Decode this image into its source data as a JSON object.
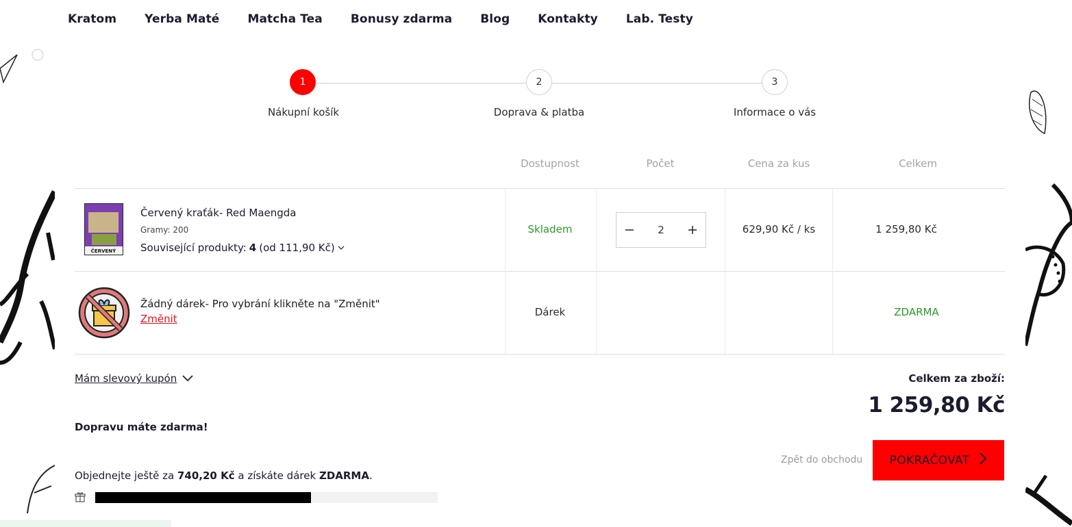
{
  "nav": [
    "Kratom",
    "Yerba Maté",
    "Matcha Tea",
    "Bonusy zdarma",
    "Blog",
    "Kontakty",
    "Lab. Testy"
  ],
  "steps": [
    {
      "num": "1",
      "label": "Nákupní košík"
    },
    {
      "num": "2",
      "label": "Doprava & platba"
    },
    {
      "num": "3",
      "label": "Informace o vás"
    }
  ],
  "table": {
    "headers": {
      "availability": "Dostupnost",
      "quantity": "Počet",
      "unit_price": "Cena za kus",
      "total": "Celkem"
    }
  },
  "product": {
    "name": "Červený kraťák- Red Maengda",
    "variant": "Gramy: 200",
    "related_label": "Související produkty:",
    "related_count": "4",
    "related_from": "(od 111,90 Kč)",
    "thumb_text": "ČERVENÝ",
    "availability": "Skladem",
    "quantity": "2",
    "unit_price": "629,90 Kč / ks",
    "total": "1 259,80 Kč"
  },
  "gift": {
    "text": "Žádný dárek- Pro vybrání klikněte na \"Změnit\"",
    "change": "Změnit",
    "type": "Dárek",
    "price": "ZDARMA"
  },
  "coupon_label": "Mám slevový kupón",
  "free_shipping": "Dopravu máte zdarma!",
  "order_more": {
    "prefix": "Objednejte ještě za",
    "amount": "740,20 Kč",
    "middle": "a získáte dárek",
    "gift": "ZDARMA",
    "suffix": "."
  },
  "progress": 0.63,
  "summary": {
    "label": "Celkem za zboží:",
    "value": "1 259,80 Kč"
  },
  "back_link": "Zpět do obchodu",
  "continue_label": "POKRAČOVAT",
  "colors": {
    "accent": "#ff0000",
    "green": "#2a9a2a",
    "link_red": "#e8141b"
  }
}
